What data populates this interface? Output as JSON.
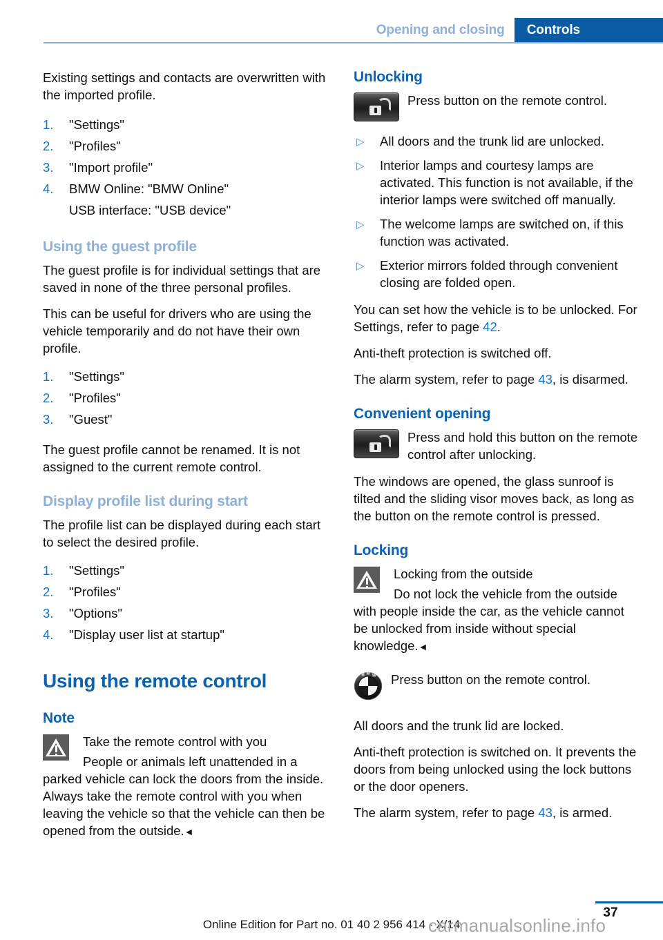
{
  "header": {
    "breadcrumb_muted": "Opening and closing",
    "tab_active": "Controls",
    "accent_blue": "#0a5da4",
    "muted_blue": "#8fb0d6"
  },
  "left_column": {
    "intro_paragraph": "Existing settings and contacts are overwritten with the imported profile.",
    "import_steps": [
      {
        "num": "1.",
        "text": "\"Settings\""
      },
      {
        "num": "2.",
        "text": "\"Profiles\""
      },
      {
        "num": "3.",
        "text": "\"Import profile\""
      },
      {
        "num": "4.",
        "text": "BMW Online: \"BMW Online\""
      }
    ],
    "import_steps_continuation": "USB interface: \"USB device\"",
    "guest_profile": {
      "heading": "Using the guest profile",
      "paragraph_1": "The guest profile is for individual settings that are saved in none of the three personal profiles.",
      "paragraph_2": "This can be useful for drivers who are using the vehicle temporarily and do not have their own profile.",
      "steps": [
        {
          "num": "1.",
          "text": "\"Settings\""
        },
        {
          "num": "2.",
          "text": "\"Profiles\""
        },
        {
          "num": "3.",
          "text": "\"Guest\""
        }
      ],
      "paragraph_3": "The guest profile cannot be renamed. It is not assigned to the current remote control."
    },
    "display_profile_list": {
      "heading": "Display profile list during start",
      "paragraph_1": "The profile list can be displayed during each start to select the desired profile.",
      "steps": [
        {
          "num": "1.",
          "text": "\"Settings\""
        },
        {
          "num": "2.",
          "text": "\"Profiles\""
        },
        {
          "num": "3.",
          "text": "\"Options\""
        },
        {
          "num": "4.",
          "text": "\"Display user list at startup\""
        }
      ]
    },
    "chapter_heading": "Using the remote control",
    "note": {
      "heading": "Note",
      "title": "Take the remote control with you",
      "body": "People or animals left unattended in a parked vehicle can lock the doors from the inside. Always take the remote control with you when leaving the vehicle so that the vehicle can then be opened from the outside.",
      "end_marker": "◄"
    }
  },
  "right_column": {
    "unlocking": {
      "heading": "Unlocking",
      "button_caption": "Press button on the remote control.",
      "bullets": [
        "All doors and the trunk lid are unlocked.",
        "Interior lamps and courtesy lamps are activated. This function is not available, if the interior lamps were switched off manually.",
        "The welcome lamps are switched on, if this function was activated.",
        "Exterior mirrors folded through convenient closing are folded open."
      ],
      "settings_text_before": "You can set how the vehicle is to be unlocked. For Settings, refer to page ",
      "settings_page_ref": "42",
      "settings_text_after": ".",
      "antitheft": "Anti-theft protection is switched off.",
      "alarm_before": "The alarm system, refer to page ",
      "alarm_page_ref": "43",
      "alarm_after": ", is disarmed."
    },
    "convenient_opening": {
      "heading": "Convenient opening",
      "button_caption": "Press and hold this button on the remote control after unlocking.",
      "paragraph": "The windows are opened, the glass sunroof is tilted and the sliding visor moves back, as long as the button on the remote control is pressed."
    },
    "locking": {
      "heading": "Locking",
      "warning_title": "Locking from the outside",
      "warning_body": "Do not lock the vehicle from the outside with people inside the car, as the vehicle cannot be unlocked from inside without special knowledge.",
      "warning_end_marker": "◄",
      "bmw_caption": "Press button on the remote control.",
      "paragraph_1": "All doors and the trunk lid are locked.",
      "paragraph_2": "Anti-theft protection is switched on. It prevents the doors from being unlocked using the lock buttons or the door openers.",
      "alarm_before": "The alarm system, refer to page ",
      "alarm_page_ref": "43",
      "alarm_after": ", is armed."
    }
  },
  "footer": {
    "edition_line": "Online Edition for Part no. 01 40 2 956 414 - X/14",
    "page_number": "37",
    "watermark": "carmanualsonline.info"
  }
}
